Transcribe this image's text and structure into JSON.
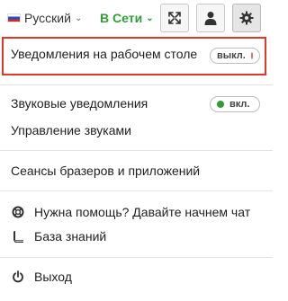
{
  "topbar": {
    "language": "Русский",
    "status": "В Сети",
    "icons": [
      "expand-icon",
      "user-icon",
      "gear-icon"
    ]
  },
  "menu": {
    "desktop_notifications": {
      "label": "Уведомления на рабочем столе",
      "toggle": "выкл."
    },
    "sound_notifications": {
      "label": "Звуковые уведомления",
      "toggle": "вкл."
    },
    "sound_management": {
      "label": "Управление звуками"
    },
    "sessions": {
      "label": "Сеансы бразеров и приложений"
    },
    "help": {
      "label": "Нужна помощь? Давайте начнем чат",
      "icon": "lifebuoy-icon"
    },
    "knowledge_base": {
      "label": "База знаний",
      "icon": "book-icon"
    },
    "logout": {
      "label": "Выход",
      "icon": "power-icon"
    }
  },
  "colors": {
    "online_green": "#2e9e36",
    "highlight_red": "#e0392b",
    "toggle_off_dot": "#e06a6a",
    "toggle_on_dot": "#2e9e36"
  }
}
